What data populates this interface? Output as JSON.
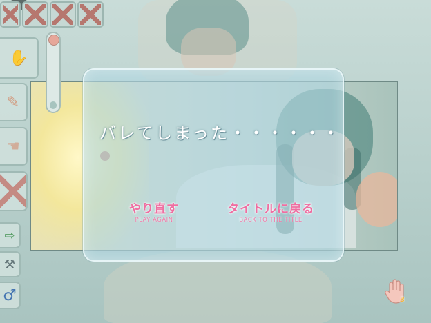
{
  "dialog": {
    "message": "バレてしまった・・・・・・",
    "retry_label": "やり直す",
    "retry_sub": "PLAY AGAIN",
    "title_label": "タイトルに戻る",
    "title_sub": "BACK TO THE TITLE"
  },
  "toolbar": {
    "slots": [
      "locked-slot-icon",
      "locked-slot-icon",
      "locked-slot-icon",
      "locked-slot-icon"
    ],
    "tools": [
      "hand-icon",
      "brush-icon",
      "arm-icon",
      "locked-tool-icon",
      "exit-door-icon",
      "wrench-icon",
      "male-symbol-icon"
    ],
    "gauge_level": 0.1
  },
  "hud": {
    "cursor_count": "3"
  },
  "colors": {
    "dialog_text": "#ffffff",
    "choice_text": "#ef6ea1",
    "lock_cross": "#c4685f"
  }
}
